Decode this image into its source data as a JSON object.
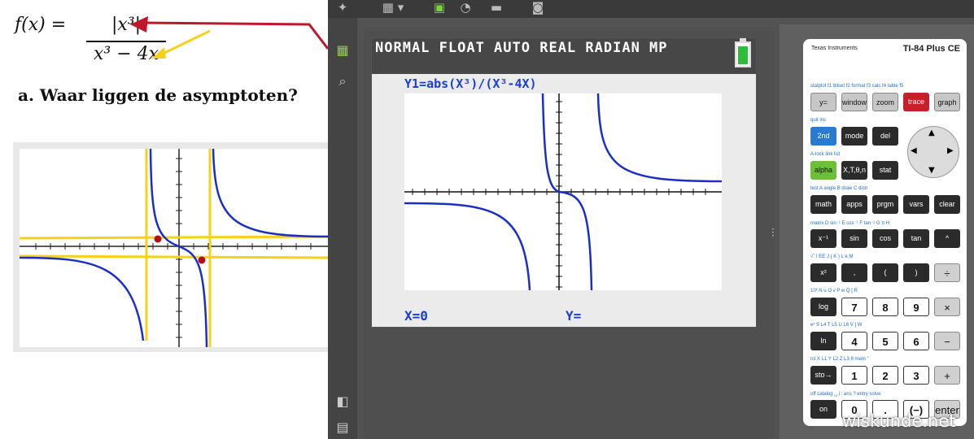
{
  "lesson": {
    "formula_lhs": "f(x) =",
    "formula_num": "|x³|",
    "formula_den": "x³ − 4x",
    "question": "a.  Waar liggen de asymptoten?"
  },
  "toolbar": {
    "calc_menu": "▦ ▾",
    "icons": [
      "emulator-icon",
      "screenshot-icon"
    ]
  },
  "screen": {
    "status": "NORMAL FLOAT AUTO REAL RADIAN MP",
    "function_line": "Y1=abs(X³)/(X³-4X)",
    "x_readout": "X=0",
    "y_readout": "Y="
  },
  "calculator": {
    "brand": "Texas Instruments",
    "model": "TI-84 Plus CE",
    "rows": [
      [
        {
          "label": "y=",
          "style": "gray"
        },
        {
          "label": "window",
          "style": "gray"
        },
        {
          "label": "zoom",
          "style": "gray"
        },
        {
          "label": "trace",
          "style": "red"
        },
        {
          "label": "graph",
          "style": "gray"
        }
      ],
      [
        {
          "label": "2nd",
          "style": "blue"
        },
        {
          "label": "mode",
          "style": "dark"
        },
        {
          "label": "del",
          "style": "dark"
        }
      ],
      [
        {
          "label": "alpha",
          "style": "green"
        },
        {
          "label": "X,T,θ,n",
          "style": "dark"
        },
        {
          "label": "stat",
          "style": "dark"
        }
      ],
      [
        {
          "label": "math",
          "style": "dark"
        },
        {
          "label": "apps",
          "style": "dark"
        },
        {
          "label": "prgm",
          "style": "dark"
        },
        {
          "label": "vars",
          "style": "dark"
        },
        {
          "label": "clear",
          "style": "dark"
        }
      ],
      [
        {
          "label": "x⁻¹",
          "style": "dark"
        },
        {
          "label": "sin",
          "style": "dark"
        },
        {
          "label": "cos",
          "style": "dark"
        },
        {
          "label": "tan",
          "style": "dark"
        },
        {
          "label": "^",
          "style": "dark"
        }
      ],
      [
        {
          "label": "x²",
          "style": "dark"
        },
        {
          "label": ",",
          "style": "dark"
        },
        {
          "label": "(",
          "style": "dark"
        },
        {
          "label": ")",
          "style": "dark"
        },
        {
          "label": "÷",
          "style": "op"
        }
      ],
      [
        {
          "label": "log",
          "style": "dark"
        },
        {
          "label": "7",
          "style": "white"
        },
        {
          "label": "8",
          "style": "white"
        },
        {
          "label": "9",
          "style": "white"
        },
        {
          "label": "×",
          "style": "op"
        }
      ],
      [
        {
          "label": "ln",
          "style": "dark"
        },
        {
          "label": "4",
          "style": "white"
        },
        {
          "label": "5",
          "style": "white"
        },
        {
          "label": "6",
          "style": "white"
        },
        {
          "label": "−",
          "style": "op"
        }
      ],
      [
        {
          "label": "sto→",
          "style": "dark"
        },
        {
          "label": "1",
          "style": "white"
        },
        {
          "label": "2",
          "style": "white"
        },
        {
          "label": "3",
          "style": "white"
        },
        {
          "label": "+",
          "style": "op"
        }
      ],
      [
        {
          "label": "on",
          "style": "dark"
        },
        {
          "label": "0",
          "style": "white"
        },
        {
          "label": ".",
          "style": "white"
        },
        {
          "label": "(−)",
          "style": "white"
        },
        {
          "label": "enter",
          "style": "op"
        }
      ]
    ],
    "second_labels": [
      "statplot f1  tblset f2  format f3  calc f4  table f5",
      "quit  ins",
      "A-lock  link  list",
      "test A  angle B  draw C  distr",
      "matrix D  sin⁻¹ E  cos⁻¹ F  tan⁻¹ G  π H",
      "√‾ I  EE J  { K  } L  e M",
      "10ˣ N  u O  v P  w Q  [ R",
      "eˣ S  L4 T  L5 U  L6 V  ] W",
      "rcl X  L1 Y  L2 Z  L3 θ  mem \"",
      "off  catalog ␣  i :  ans ?  entry solve"
    ]
  },
  "watermark": "wiskunde.net",
  "colors": {
    "plot_blue": "#1a3fd0",
    "asymptote_yellow": "#f5d21a",
    "annot_red": "#c0182a"
  }
}
